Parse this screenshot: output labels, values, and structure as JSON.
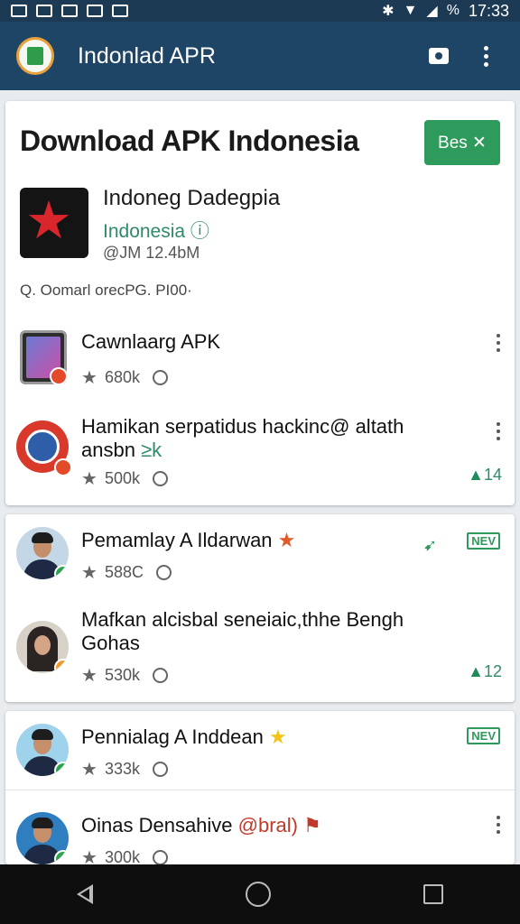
{
  "status_bar": {
    "battery_label": "%",
    "time": "17:33"
  },
  "app_bar": {
    "title": "Indonlad APR",
    "logo_icon": "app-logo-icon",
    "actions": [
      "camera-icon",
      "overflow-menu-icon"
    ]
  },
  "header": {
    "title": "Download APK Indonesia",
    "beta_button": "Bes ✕"
  },
  "featured": {
    "name": "Indoneg Dadegpia",
    "subtitle": "Indonesia ⓘ",
    "meta": "@JM 12.4bM",
    "search_text": "Q. Oomarl orecPG. PI00·"
  },
  "colors": {
    "app_bar": "#1f4566",
    "status_bar": "#1d3a55",
    "accent_green": "#2e9a5b",
    "link_green": "#2e8a68",
    "nav_bar": "#0e0e0e"
  },
  "items": [
    {
      "title": "Cawnlaarg APK",
      "rating": "680k",
      "icon": "tablet-app-icon"
    },
    {
      "title_line1": "Hamikan serpatidus hackinc@ altath",
      "title_line2": "ansbn",
      "title_suffix": "≥k",
      "rating": "500k",
      "votes": "14",
      "icon": "circle-app-icon"
    },
    {
      "title": "Pemamlay A Ildarwan",
      "rating": "588C",
      "tag": "NEV",
      "icon": "avatar-man-icon"
    },
    {
      "title_line1": "Mafkan alcisbal  seneiaic,thhe Bengh",
      "title_line2": "Gohas",
      "rating": "530k",
      "votes": "12",
      "icon": "avatar-woman-icon"
    },
    {
      "title": "Pennialag A Inddean",
      "rating": "333k",
      "tag": "NEV",
      "icon": "avatar-man-icon"
    },
    {
      "title_plain": "Oinas Densahive ",
      "title_highlight": "@bral)",
      "rating": "300k",
      "icon": "avatar-man-icon"
    }
  ],
  "nav": [
    "back-icon",
    "home-icon",
    "recents-icon"
  ]
}
